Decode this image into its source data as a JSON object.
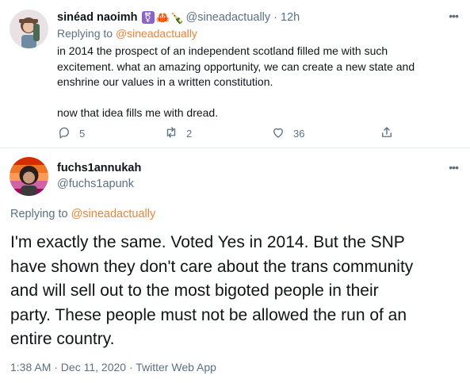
{
  "parent_tweet": {
    "author_name": "sinéad naoimh",
    "emojis": [
      "transgender-symbol-emoji",
      "crab-emoji",
      "bottle-emoji"
    ],
    "trans_symbol": "⚧",
    "crab": "🦀",
    "bottle": "🍾",
    "handle": "@sineadactually",
    "separator": "·",
    "time": "12h",
    "more": "•••",
    "replying_prefix": "Replying to ",
    "replying_to": "@sineadactually",
    "body_lines": [
      "in 2014 the prospect of an independent scotland filled me with such",
      "excitement. what an amazing opportunity, we can create a new state and",
      "enshrine our values in a written constitution.",
      "now that idea fills me with dread."
    ],
    "reply_count": "5",
    "retweet_count": "2",
    "like_count": "36"
  },
  "main_tweet": {
    "author_name": "fuchs1annukah",
    "handle": "@fuchs1apunk",
    "more": "•••",
    "replying_prefix": "Replying to ",
    "replying_to": "@sineadactually",
    "body_lines": [
      "I'm exactly the same. Voted Yes in 2014. But the SNP",
      "have shown they don't care about the trans community",
      "and will sell out to the most bigoted people in their",
      "party. These people must not be allowed the run of an",
      "entire country."
    ],
    "timestamp": "1:38 AM · Dec 11, 2020 · Twitter Web App"
  },
  "colors": {
    "text": "#0f1419",
    "secondary": "#5b7083",
    "mention": "#e8843a",
    "divider": "#e6ecf0"
  }
}
